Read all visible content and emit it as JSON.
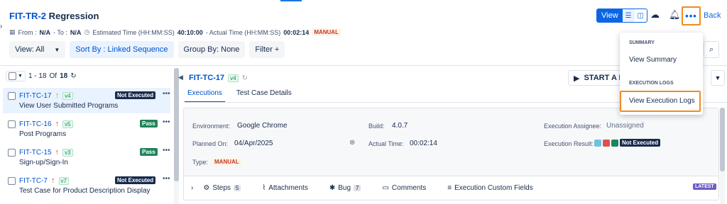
{
  "header": {
    "key": "FIT-TR-2",
    "title": "Regression",
    "from_label": "From :",
    "from_value": "N/A",
    "to_label": "- To :",
    "to_value": "N/A",
    "est_label": "Estimated Time (HH:MM:SS)",
    "est_value": "40:10:00",
    "actual_label": "- Actual Time (HH:MM:SS)",
    "actual_value": "00:02:14",
    "type_tag": "MANUAL",
    "view_label": "View",
    "back_label": "Back"
  },
  "toolbar": {
    "view_filter": "View: All",
    "sort": "Sort By : Linked Sequence",
    "group": "Group By: None",
    "filter": "Filter +"
  },
  "menu": {
    "summary_section": "SUMMARY",
    "view_summary": "View Summary",
    "logs_section": "EXECUTION LOGS",
    "view_logs": "View Execution Logs"
  },
  "list": {
    "range": "1 - 18",
    "of_label": "Of",
    "total": "18",
    "items": [
      {
        "key": "FIT-TC-17",
        "version": "v4",
        "status": "Not Executed",
        "name": "View User Submitted Programs",
        "priority_color": "#f08c21"
      },
      {
        "key": "FIT-TC-16",
        "version": "v5",
        "status": "Pass",
        "name": "Post Programs",
        "priority_color": "#e2483d"
      },
      {
        "key": "FIT-TC-15",
        "version": "v3",
        "status": "Pass",
        "name": "Sign-up/Sign-In",
        "priority_color": "#e2483d"
      },
      {
        "key": "FIT-TC-7",
        "version": "v7",
        "status": "Not Executed",
        "name": "Test Case for Product Description Display",
        "priority_color": "#e2483d"
      }
    ]
  },
  "detail": {
    "key": "FIT-TC-17",
    "version": "v4",
    "start_label": "START A NE",
    "tabs": [
      "Executions",
      "Test Case Details"
    ],
    "environment_label": "Environment:",
    "environment_value": "Google Chrome",
    "build_label": "Build:",
    "build_value": "4.0.7",
    "assignee_label": "Execution Assignee:",
    "assignee_value": "Unassigned",
    "planned_label": "Planned On:",
    "planned_value": "04/Apr/2025",
    "actual_label": "Actual Time:",
    "actual_value": "00:02:14",
    "result_label": "Execution Result:",
    "result_value": "Not Executed",
    "type_label": "Type:",
    "type_value": "MANUAL",
    "footer": {
      "steps": "Steps",
      "steps_count": "5",
      "attachments": "Attachments",
      "bug": "Bug",
      "bug_count": "7",
      "comments": "Comments",
      "custom_fields": "Execution Custom Fields",
      "latest": "LATEST"
    }
  },
  "colors": {
    "accent": "#0c66e4",
    "highlight": "#f08c21",
    "pass": "#1f845a",
    "not_executed": "#172b4d"
  }
}
